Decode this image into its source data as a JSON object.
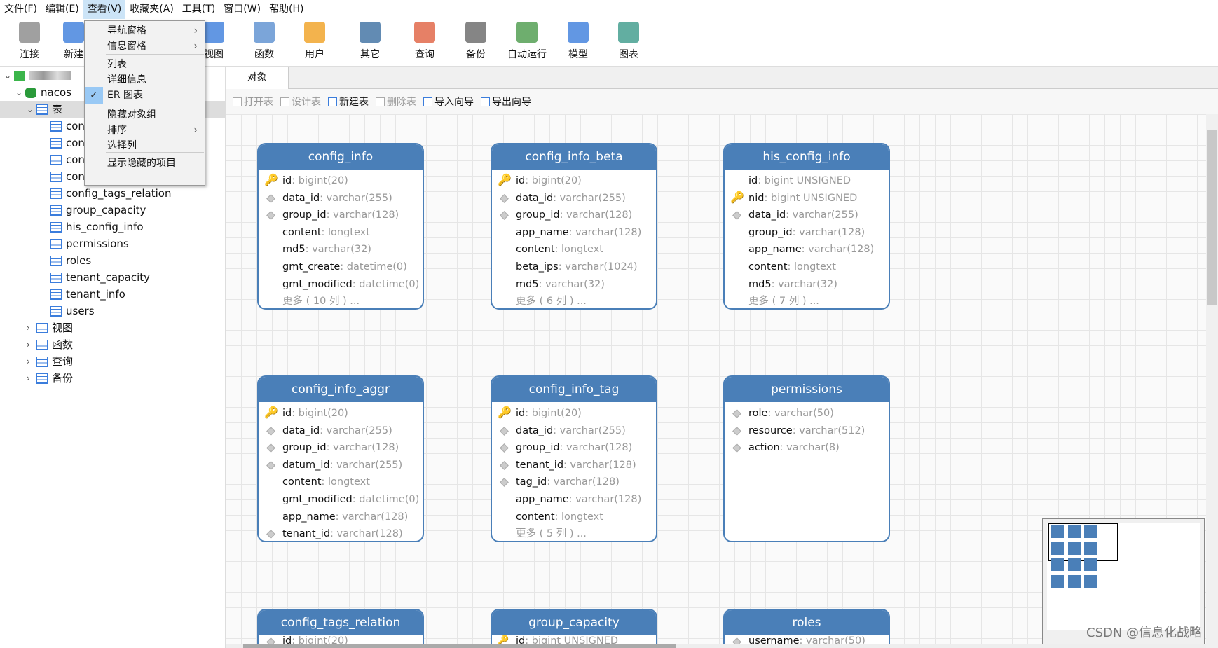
{
  "menubar": [
    "文件(F)",
    "编辑(E)",
    "查看(V)",
    "收藏夹(A)",
    "工具(T)",
    "窗口(W)",
    "帮助(H)"
  ],
  "toolbar": [
    {
      "label": "连接",
      "icon": "plug-icon",
      "color": "#888"
    },
    {
      "label": "新建",
      "icon": "table-new-icon",
      "color": "#3b7ddc"
    },
    {
      "label": "视图",
      "icon": "view-icon",
      "color": "#3b7ddc"
    },
    {
      "label": "函数",
      "icon": "function-icon",
      "color": "#5a8fd0"
    },
    {
      "label": "用户",
      "icon": "user-icon",
      "color": "#f0a020"
    },
    {
      "label": "其它",
      "icon": "tools-icon",
      "color": "#3b6ea0"
    },
    {
      "label": "查询",
      "icon": "query-icon",
      "color": "#e06040"
    },
    {
      "label": "备份",
      "icon": "backup-icon",
      "color": "#666"
    },
    {
      "label": "自动运行",
      "icon": "schedule-icon",
      "color": "#4a9a4a"
    },
    {
      "label": "模型",
      "icon": "model-icon",
      "color": "#3b7ddc"
    },
    {
      "label": "图表",
      "icon": "chart-icon",
      "color": "#3b9a8a"
    }
  ],
  "dropdown": {
    "items": [
      {
        "label": "导航窗格",
        "submenu": true
      },
      {
        "label": "信息窗格",
        "submenu": true
      },
      {
        "label": "列表"
      },
      {
        "label": "详细信息"
      },
      {
        "label": "ER 图表",
        "checked": true
      },
      {
        "label": "隐藏对象组"
      },
      {
        "label": "排序",
        "submenu": true
      },
      {
        "label": "选择列"
      },
      {
        "label": "显示隐藏的项目"
      }
    ],
    "arrow": "›",
    "check": "✓"
  },
  "sidebar": {
    "db": "nacos",
    "tables_label": "表",
    "tables": [
      "con",
      "con",
      "con",
      "con",
      "config_tags_relation",
      "group_capacity",
      "his_config_info",
      "permissions",
      "roles",
      "tenant_capacity",
      "tenant_info",
      "users"
    ],
    "groups": [
      "视图",
      "函数",
      "查询",
      "备份"
    ]
  },
  "tab": "对象",
  "objbar": [
    {
      "label": "打开表",
      "disabled": true
    },
    {
      "label": "设计表",
      "disabled": true
    },
    {
      "label": "新建表"
    },
    {
      "label": "删除表",
      "disabled": true
    },
    {
      "label": "导入向导"
    },
    {
      "label": "导出向导"
    }
  ],
  "er_tables": [
    {
      "name": "config_info",
      "fields": [
        [
          "id",
          "bigint(20)",
          "key"
        ],
        [
          "data_id",
          "varchar(255)",
          "dia"
        ],
        [
          "group_id",
          "varchar(128)",
          "dia"
        ],
        [
          "content",
          "longtext",
          ""
        ],
        [
          "md5",
          "varchar(32)",
          ""
        ],
        [
          "gmt_create",
          "datetime(0)",
          ""
        ],
        [
          "gmt_modified",
          "datetime(0)",
          ""
        ]
      ],
      "more": "更多 ( 10 列 ) ..."
    },
    {
      "name": "config_info_beta",
      "fields": [
        [
          "id",
          "bigint(20)",
          "key"
        ],
        [
          "data_id",
          "varchar(255)",
          "dia"
        ],
        [
          "group_id",
          "varchar(128)",
          "dia"
        ],
        [
          "app_name",
          "varchar(128)",
          ""
        ],
        [
          "content",
          "longtext",
          ""
        ],
        [
          "beta_ips",
          "varchar(1024)",
          ""
        ],
        [
          "md5",
          "varchar(32)",
          ""
        ]
      ],
      "more": "更多 ( 6 列 ) ..."
    },
    {
      "name": "his_config_info",
      "fields": [
        [
          "id",
          "bigint UNSIGNED",
          ""
        ],
        [
          "nid",
          "bigint UNSIGNED",
          "key"
        ],
        [
          "data_id",
          "varchar(255)",
          "dia"
        ],
        [
          "group_id",
          "varchar(128)",
          ""
        ],
        [
          "app_name",
          "varchar(128)",
          ""
        ],
        [
          "content",
          "longtext",
          ""
        ],
        [
          "md5",
          "varchar(32)",
          ""
        ]
      ],
      "more": "更多 ( 7 列 ) ..."
    },
    {
      "name": "config_info_aggr",
      "fields": [
        [
          "id",
          "bigint(20)",
          "key"
        ],
        [
          "data_id",
          "varchar(255)",
          "dia"
        ],
        [
          "group_id",
          "varchar(128)",
          "dia"
        ],
        [
          "datum_id",
          "varchar(255)",
          "dia"
        ],
        [
          "content",
          "longtext",
          ""
        ],
        [
          "gmt_modified",
          "datetime(0)",
          ""
        ],
        [
          "app_name",
          "varchar(128)",
          ""
        ],
        [
          "tenant_id",
          "varchar(128)",
          "dia"
        ]
      ]
    },
    {
      "name": "config_info_tag",
      "fields": [
        [
          "id",
          "bigint(20)",
          "key"
        ],
        [
          "data_id",
          "varchar(255)",
          "dia"
        ],
        [
          "group_id",
          "varchar(128)",
          "dia"
        ],
        [
          "tenant_id",
          "varchar(128)",
          "dia"
        ],
        [
          "tag_id",
          "varchar(128)",
          "dia"
        ],
        [
          "app_name",
          "varchar(128)",
          ""
        ],
        [
          "content",
          "longtext",
          ""
        ]
      ],
      "more": "更多 ( 5 列 ) ..."
    },
    {
      "name": "permissions",
      "fields": [
        [
          "role",
          "varchar(50)",
          "dia"
        ],
        [
          "resource",
          "varchar(512)",
          "dia"
        ],
        [
          "action",
          "varchar(8)",
          "dia"
        ]
      ]
    },
    {
      "name": "config_tags_relation",
      "fields": [
        [
          "id",
          "bigint(20)",
          "dia"
        ]
      ]
    },
    {
      "name": "group_capacity",
      "fields": [
        [
          "id",
          "bigint UNSIGNED",
          "key"
        ]
      ]
    },
    {
      "name": "roles",
      "fields": [
        [
          "username",
          "varchar(50)",
          "dia"
        ]
      ]
    }
  ],
  "watermark": "CSDN @信息化战略",
  "colors": {
    "header": "#4a7fb8",
    "key": "#e6a817"
  }
}
